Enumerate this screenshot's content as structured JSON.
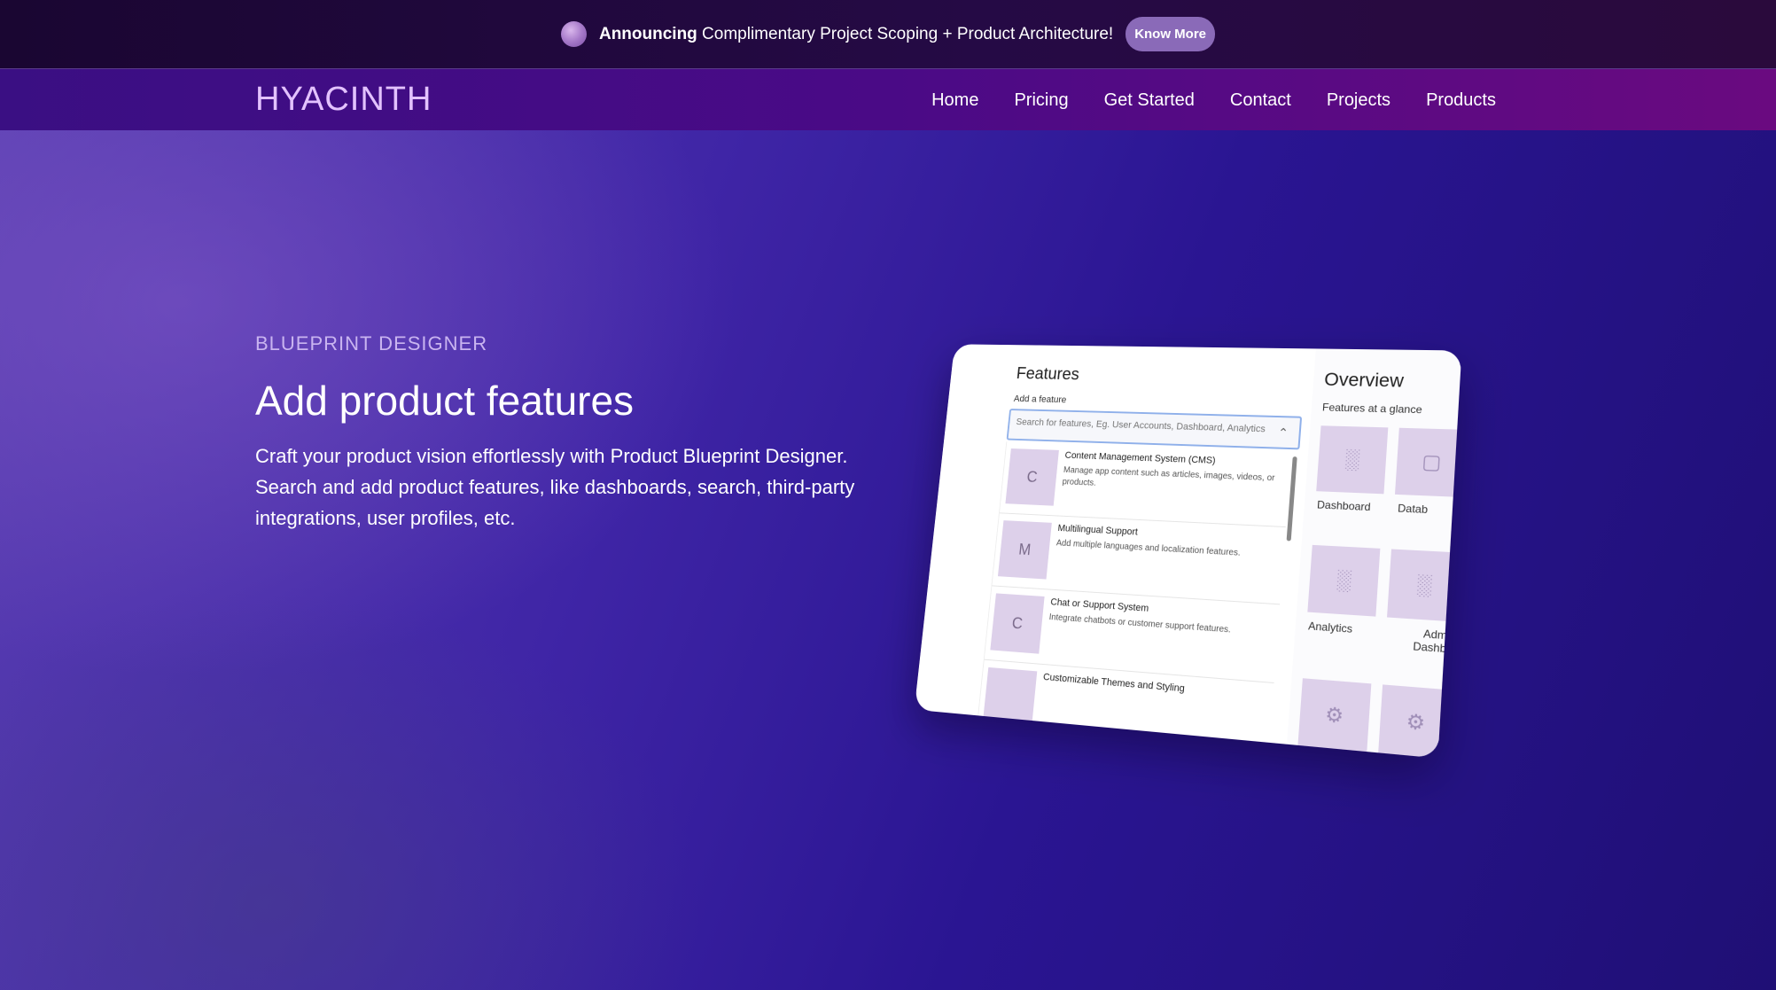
{
  "announcement": {
    "bold": "Announcing",
    "text": " Complimentary Project Scoping + Product Architecture!",
    "button": "Know More",
    "orb_icon": "sparkle-orb-icon"
  },
  "nav": {
    "logo": "HYACINTH",
    "links": [
      "Home",
      "Pricing",
      "Get Started",
      "Contact",
      "Projects",
      "Products"
    ]
  },
  "hero": {
    "eyebrow": "BLUEPRINT DESIGNER",
    "title": "Add product features",
    "description": "Craft your product vision effortlessly with Product Blueprint Designer. Search and add product features, like dashboards, search, third-party integrations, user profiles, etc."
  },
  "mock": {
    "features_title": "Features",
    "add_label": "Add a feature",
    "search_placeholder": "Search for features, Eg. User Accounts, Dashboard, Analytics",
    "items": [
      {
        "letter": "C",
        "name": "Content Management System (CMS)",
        "desc": "Manage app content such as articles, images, videos, or products."
      },
      {
        "letter": "M",
        "name": "Multilingual Support",
        "desc": "Add multiple languages and localization features."
      },
      {
        "letter": "C",
        "name": "Chat or Support System",
        "desc": "Integrate chatbots or customer support features."
      },
      {
        "letter": "",
        "name": "Customizable Themes and Styling",
        "desc": ""
      }
    ],
    "overview_title": "Overview",
    "overview_sub": "Features at a glance",
    "tiles": [
      {
        "label": "Dashboard",
        "icon": "bar-chart-icon"
      },
      {
        "label": "Datab",
        "icon": "database-icon"
      },
      {
        "label": "Analytics",
        "icon": "bar-chart-icon"
      },
      {
        "label": "Adm Dashb",
        "icon": "bar-chart-icon"
      },
      {
        "label": "",
        "icon": "gear-icon"
      },
      {
        "label": "",
        "icon": "gear-icon"
      }
    ]
  },
  "colors": {
    "accent": "#8a6ab8",
    "logo": "#e3c2ff",
    "eyebrow": "#c9b4f0",
    "tile": "#ddd0ea"
  }
}
